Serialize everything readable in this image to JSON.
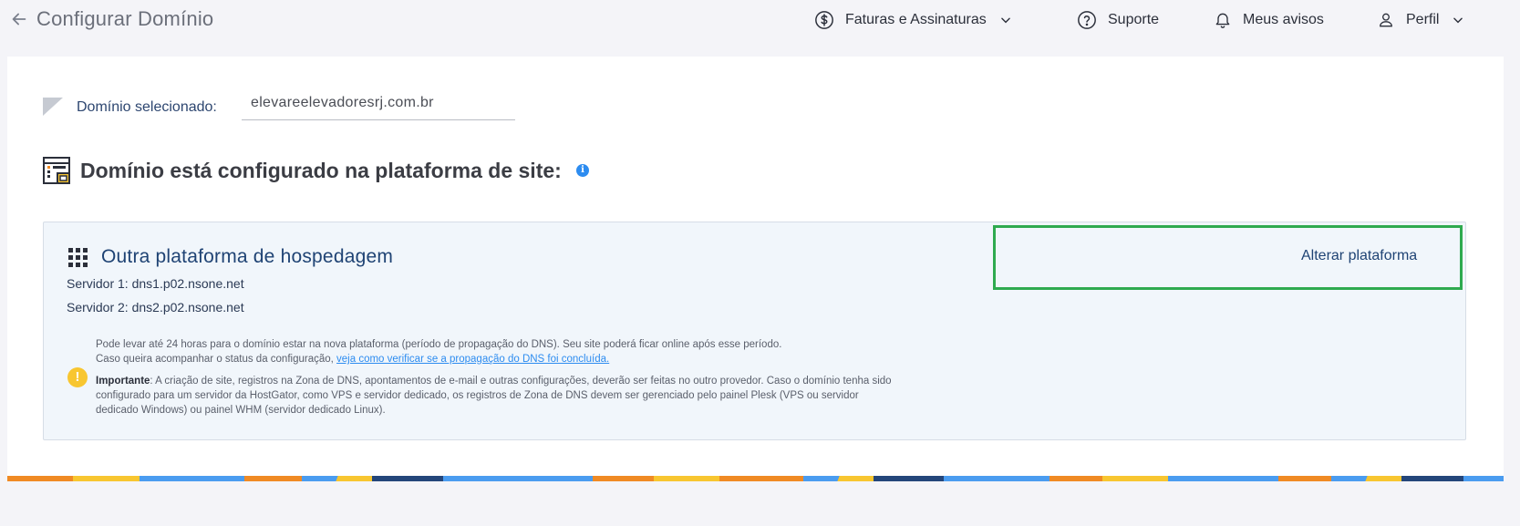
{
  "header": {
    "title": "Configurar Domínio",
    "nav": [
      {
        "label": "Faturas e Assinaturas"
      },
      {
        "label": "Suporte"
      },
      {
        "label": "Meus avisos"
      },
      {
        "label": "Perfil"
      }
    ]
  },
  "domain": {
    "label": "Domínio selecionado:",
    "value": "elevareelevadoresrj.com.br"
  },
  "section": {
    "title": "Domínio está configurado na plataforma de site:",
    "info_icon": "i"
  },
  "platform": {
    "name": "Outra plataforma de hospedagem",
    "servers": [
      "Servidor 1: dns1.p02.nsone.net",
      "Servidor 2: dns2.p02.nsone.net"
    ],
    "change_label": "Alterar plataforma"
  },
  "notice": {
    "line1": "Pode levar até 24 horas para o domínio estar na nova plataforma (período de propagação do DNS). Seu site poderá ficar online após esse período.",
    "line2_prefix": "Caso queira acompanhar o status da configuração, ",
    "line2_link": "veja como verificar se a propagação do DNS foi concluída.",
    "important_label": "Importante",
    "important_text": ": A criação de site, registros na Zona de DNS, apontamentos de e-mail e outras configurações, deverão ser feitas no outro provedor. Caso o domínio tenha sido configurado para um servidor da HostGator, como VPS e servidor dedicado, os registros de Zona de DNS devem ser gerenciado pelo painel Plesk (VPS ou servidor dedicado Windows) ou painel WHM (servidor dedicado Linux)."
  },
  "colors": {
    "highlight": "#2faa4f",
    "link": "#2d8cf0",
    "warning": "#f8c630",
    "brand_blue": "#1f4374"
  },
  "icons": [
    "back-arrow-icon",
    "dollar-circle-icon",
    "chevron-down-icon",
    "help-circle-icon",
    "bell-icon",
    "user-icon",
    "flag-icon",
    "platform-icon",
    "info-icon",
    "grid-icon",
    "warning-icon"
  ]
}
